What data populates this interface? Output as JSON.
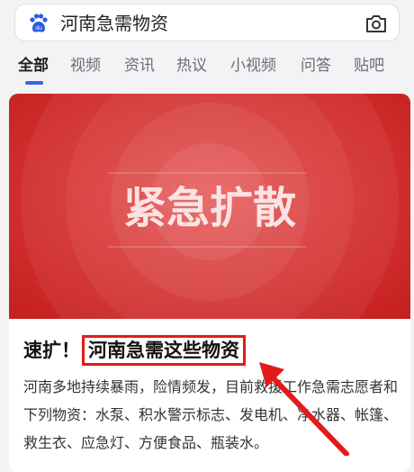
{
  "search": {
    "query": "河南急需物资",
    "logo_text": "du"
  },
  "tabs": [
    {
      "label": "全部",
      "active": true
    },
    {
      "label": "视频"
    },
    {
      "label": "资讯"
    },
    {
      "label": "热议"
    },
    {
      "label": "小视频"
    },
    {
      "label": "问答"
    },
    {
      "label": "贴吧"
    }
  ],
  "banner": {
    "title": "紧急扩散",
    "bg_color": "#d42b2b"
  },
  "article": {
    "title_prefix": "速扩！",
    "title_highlight": "河南急需这些物资",
    "body": "河南多地持续暴雨，险情频发，目前救援工作急需志愿者和下列物资：水泵、积水警示标志、发电机、净水器、帐篷、救生衣、应急灯、方便食品、瓶装水。"
  },
  "colors": {
    "accent": "#3464f0",
    "highlight": "#e11b1b"
  }
}
